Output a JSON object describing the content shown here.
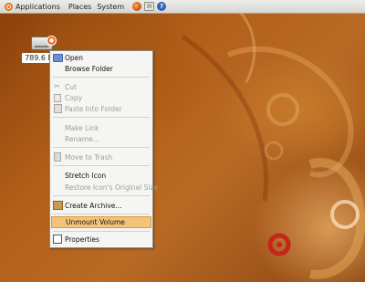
{
  "panel": {
    "applications_label": "Applications",
    "places_label": "Places",
    "system_label": "System",
    "launchers": [
      {
        "icon": "firefox-icon"
      },
      {
        "icon": "mail-icon",
        "glyph": "✉"
      },
      {
        "icon": "help-icon",
        "glyph": "?"
      }
    ]
  },
  "desktop": {
    "volume_label": "789.6 MB",
    "volume_label_visible": "789.6 MB"
  },
  "menu": {
    "items": [
      {
        "label": "Open",
        "enabled": true,
        "icon": "folder-open-icon"
      },
      {
        "label": "Browse Folder",
        "enabled": true
      },
      {
        "label": "Cut",
        "enabled": false,
        "icon": "scissors-icon"
      },
      {
        "label": "Copy",
        "enabled": false,
        "icon": "copy-icon"
      },
      {
        "label": "Paste Into Folder",
        "enabled": false,
        "icon": "paste-icon"
      },
      {
        "label": "Make Link",
        "enabled": false
      },
      {
        "label": "Rename...",
        "enabled": false
      },
      {
        "label": "Move to Trash",
        "enabled": false,
        "icon": "trash-icon"
      },
      {
        "label": "Stretch Icon",
        "enabled": true
      },
      {
        "label": "Restore Icon's Original Size",
        "enabled": false
      },
      {
        "label": "Create Archive...",
        "enabled": true,
        "icon": "archive-icon"
      },
      {
        "label": "Unmount Volume",
        "enabled": true,
        "highlighted": true
      },
      {
        "label": "Properties",
        "enabled": true,
        "icon": "properties-icon"
      }
    ]
  },
  "colors": {
    "highlight": "#f4c37a",
    "panel": "#e4e2de",
    "wallpaper": "#b25f19"
  }
}
